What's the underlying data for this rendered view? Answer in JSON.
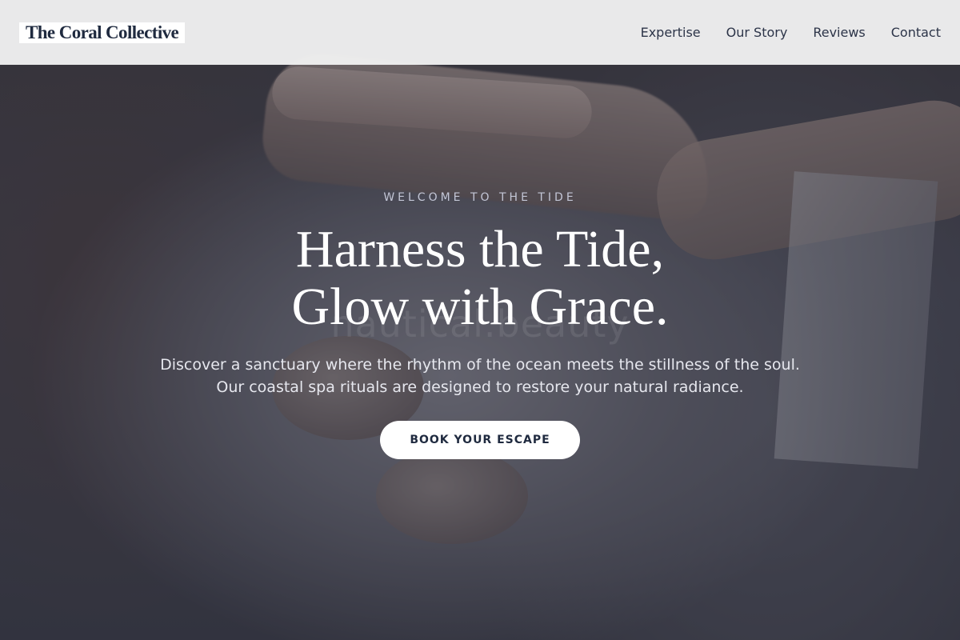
{
  "brand": {
    "name": "The Coral Collective"
  },
  "nav": {
    "items": [
      {
        "label": "Expertise"
      },
      {
        "label": "Our Story"
      },
      {
        "label": "Reviews"
      },
      {
        "label": "Contact"
      }
    ]
  },
  "hero": {
    "eyebrow": "WELCOME TO THE TIDE",
    "headline_line1": "Harness the Tide,",
    "headline_line2": "Glow with Grace.",
    "watermark": "nautical.beauty",
    "lead_line1": "Discover a sanctuary where the rhythm of the ocean meets the stillness of the soul.",
    "lead_line2": "Our coastal spa rituals are designed to restore your natural radiance.",
    "cta_label": "BOOK YOUR ESCAPE"
  },
  "colors": {
    "header_bg": "#f0f0f0",
    "brand_text": "#1f2a3f",
    "nav_text": "#2c3448",
    "eyebrow_text": "#c3c6d6",
    "cta_bg": "#ffffff",
    "cta_text": "#1f2a3f"
  }
}
